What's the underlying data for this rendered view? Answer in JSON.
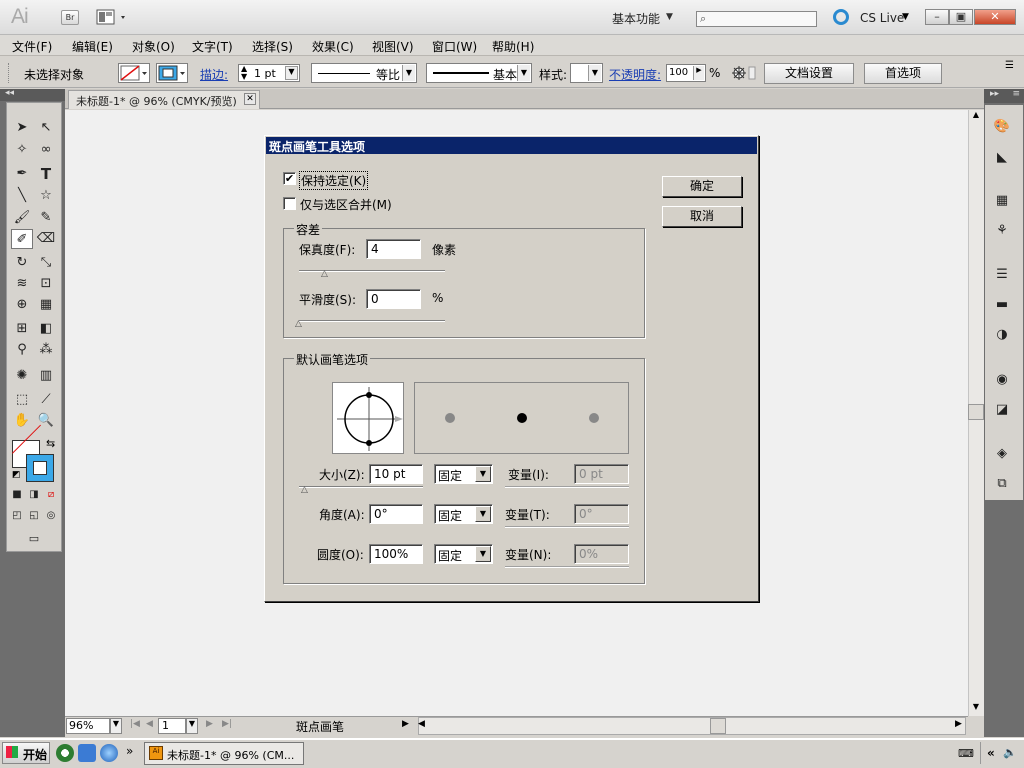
{
  "app": {
    "logo": "Ai",
    "bridge_label": "Br",
    "workspace": "基本功能",
    "search_placeholder": "",
    "cs_live": "CS Live",
    "window_buttons": {
      "minimize": "–",
      "restore": "▣",
      "close": "✕"
    }
  },
  "menu": [
    "文件(F)",
    "编辑(E)",
    "对象(O)",
    "文字(T)",
    "选择(S)",
    "效果(C)",
    "视图(V)",
    "窗口(W)",
    "帮助(H)"
  ],
  "control_bar": {
    "no_selection": "未选择对象",
    "stroke_label": "描边:",
    "stroke_weight": "1 pt",
    "profile": "等比",
    "brush": "基本",
    "style_label": "样式:",
    "opacity_label": "不透明度:",
    "opacity_value": "100",
    "opacity_unit": "%",
    "document_setup": "文档设置",
    "preferences": "首选项"
  },
  "document": {
    "tab_title": "未标题-1* @ 96% (CMYK/预览)",
    "tab_close": "✕"
  },
  "status_bar": {
    "zoom": "96%",
    "page": "1",
    "current_tool": "斑点画笔"
  },
  "taskbar": {
    "start": "开始",
    "task_title": "未标题-1* @ 96% (CM...",
    "task_icon": "Ai",
    "more": "»"
  },
  "dialog": {
    "title": "斑点画笔工具选项",
    "keep_selected": {
      "label": "保持选定(K)",
      "checked": true
    },
    "merge_only_selection": {
      "label": "仅与选区合并(M)",
      "checked": false
    },
    "ok": "确定",
    "cancel": "取消",
    "tolerances": {
      "group_label": "容差",
      "fidelity_label": "保真度(F):",
      "fidelity_value": "4",
      "fidelity_unit": "像素",
      "smoothness_label": "平滑度(S):",
      "smoothness_value": "0",
      "smoothness_unit": "%"
    },
    "brush_options": {
      "group_label": "默认画笔选项",
      "size_label": "大小(Z):",
      "size_value": "10 pt",
      "size_mode": "固定",
      "size_variation_label": "变量(I):",
      "size_variation_value": "0 pt",
      "angle_label": "角度(A):",
      "angle_value": "0°",
      "angle_mode": "固定",
      "angle_variation_label": "变量(T):",
      "angle_variation_value": "0°",
      "roundness_label": "圆度(O):",
      "roundness_value": "100%",
      "roundness_mode": "固定",
      "roundness_variation_label": "变量(N):",
      "roundness_variation_value": "0%"
    }
  },
  "colors": {
    "dialog_title_bg": "#0a246a",
    "stroke_swatch": "#3ba8e8",
    "link_blue": "#1a3eb3"
  }
}
